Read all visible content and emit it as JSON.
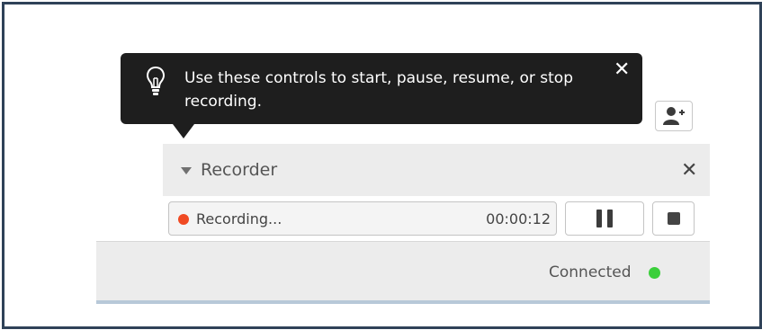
{
  "tooltip": {
    "text": "Use these controls to start, pause, resume, or stop recording.",
    "close_glyph": "✕",
    "icon": "lightbulb-icon"
  },
  "header": {
    "add_person_icon": "add-person-icon"
  },
  "recorder": {
    "title": "Recorder",
    "collapse_icon": "triangle-down-icon",
    "close_glyph": "✕",
    "status_text": "Recording...",
    "elapsed": "00:00:12",
    "pause_icon": "pause-icon",
    "stop_icon": "stop-icon"
  },
  "status_bar": {
    "connection_label": "Connected"
  },
  "colors": {
    "recording_dot": "#f04a23",
    "connected_dot": "#3bcf3b",
    "tooltip_bg": "#1e1e1e",
    "frame_border": "#2f4258"
  }
}
